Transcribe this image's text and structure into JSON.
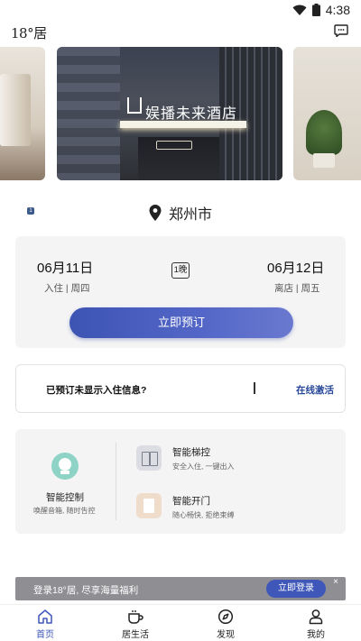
{
  "status_bar": {
    "time": "4:38"
  },
  "header": {
    "logo": "18°居"
  },
  "carousel": {
    "hotel_sign": "娱播未来酒店",
    "active_index": "1",
    "slide_count": 4
  },
  "location": {
    "city": "郑州市"
  },
  "booking": {
    "checkin_date": "06月11日",
    "checkin_label": "入住 | 周四",
    "nights": "1晚",
    "checkout_date": "06月12日",
    "checkout_label": "离店 | 周五",
    "book_button": "立即预订"
  },
  "activate": {
    "question": "已预订未显示入住信息?",
    "link": "在线激活"
  },
  "smart": {
    "control_title": "智能控制",
    "control_sub": "唤醒音箱, 随时告控",
    "features": [
      {
        "title": "智能梯控",
        "sub": "安全入住, 一键出入"
      },
      {
        "title": "智能开门",
        "sub": "随心畅快, 拒绝束缚"
      }
    ]
  },
  "login_banner": {
    "text": "登录18°居, 尽享海量福利",
    "button": "立即登录",
    "close": "×"
  },
  "bottom_nav": [
    {
      "label": "首页",
      "icon": "home-icon",
      "active": true
    },
    {
      "label": "居生活",
      "icon": "cup-icon",
      "active": false
    },
    {
      "label": "发现",
      "icon": "compass-icon",
      "active": false
    },
    {
      "label": "我的",
      "icon": "person-icon",
      "active": false
    }
  ],
  "colors": {
    "primary": "#3e57b8",
    "card_bg": "#f4f4f4",
    "banner_bg": "#8f8f93",
    "mint": "#8fd3c7"
  }
}
